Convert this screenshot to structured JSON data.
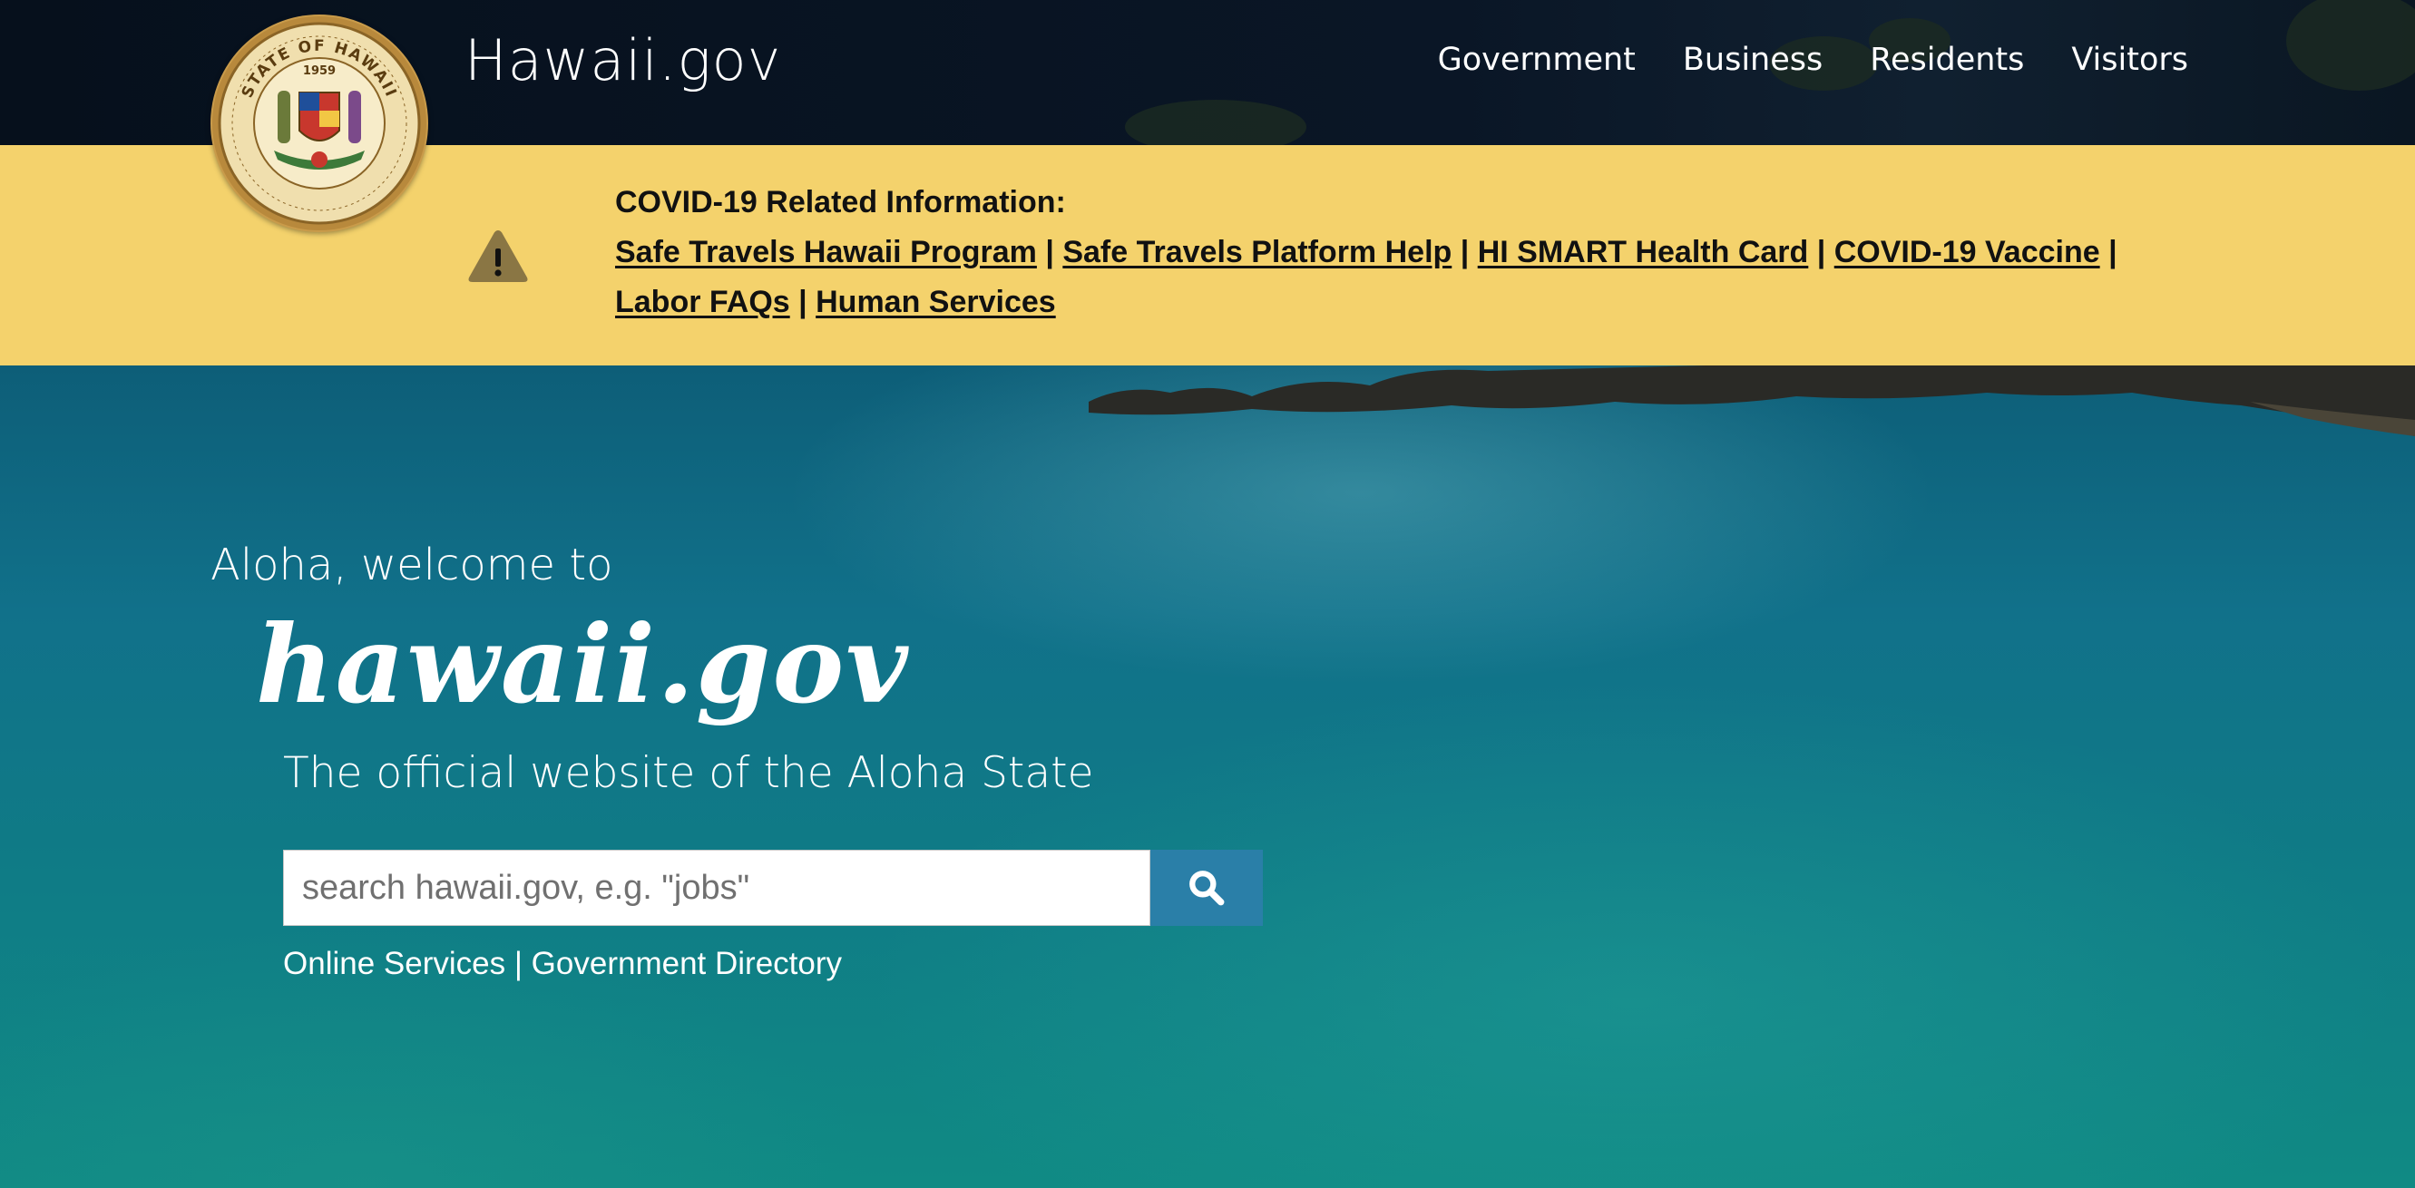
{
  "header": {
    "site_title": "Hawaii.gov",
    "seal": {
      "outer_text": "STATE OF HAWAII",
      "year": "1959",
      "icon": "state-seal-icon"
    },
    "nav": [
      {
        "label": "Government"
      },
      {
        "label": "Business"
      },
      {
        "label": "Residents"
      },
      {
        "label": "Visitors"
      }
    ]
  },
  "alert": {
    "icon": "warning-icon",
    "title": "COVID-19 Related Information:",
    "separator": "|",
    "links": [
      {
        "label": "Safe Travels Hawaii Program"
      },
      {
        "label": "Safe Travels Platform Help"
      },
      {
        "label": "HI SMART Health Card"
      },
      {
        "label": "COVID-19 Vaccine"
      },
      {
        "label": "Labor FAQs"
      },
      {
        "label": "Human Services"
      }
    ]
  },
  "hero": {
    "kicker": "Aloha, welcome to",
    "script_title": "hawaii.gov",
    "tagline": "The official website of the Aloha State",
    "search": {
      "placeholder": "search hawaii.gov, e.g. \"jobs\"",
      "value": "",
      "button_icon": "search-icon"
    },
    "quick_links": {
      "online_services": "Online Services",
      "separator": "|",
      "government_directory": "Government Directory"
    }
  },
  "colors": {
    "header_bg": "#0a1626",
    "alert_bg": "#f4d26c",
    "search_button": "#2a7fa8",
    "water": "#0f7b86"
  }
}
